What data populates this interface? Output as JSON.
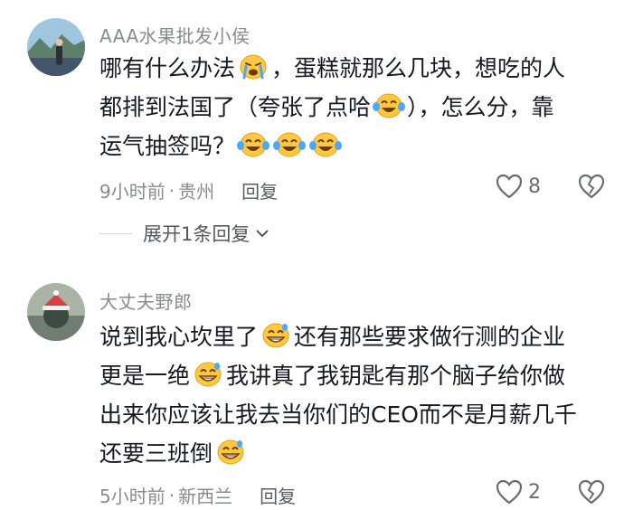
{
  "comments": [
    {
      "author": "AAA水果批发小侯",
      "lines": [
        {
          "segments": [
            "哪有什么办法",
            "emoji:sob",
            "，蛋糕就那么几块，想吃的人"
          ]
        },
        {
          "segments": [
            "都排到法国了（夸张了点哈",
            "emoji:laugh-cry",
            "），怎么分，靠"
          ]
        },
        {
          "segments": [
            "运气抽签吗？",
            "emoji:laugh-cry",
            "emoji:laugh-cry",
            "emoji:laugh-cry"
          ]
        }
      ],
      "time": "9小时前",
      "location": "贵州",
      "reply": "回复",
      "likes": "8",
      "expand_replies": "展开1条回复"
    },
    {
      "author": "大丈夫野郎",
      "lines": [
        {
          "segments": [
            "说到我心坎里了",
            "emoji:grin-sweat",
            "还有那些要求做行测的企业"
          ]
        },
        {
          "segments": [
            "更是一绝",
            "emoji:grin-sweat",
            "我讲真了我钥匙有那个脑子给你做"
          ]
        },
        {
          "segments": [
            "出来你应该让我去当你们的CEO而不是月薪几千"
          ]
        },
        {
          "segments": [
            "还要三班倒",
            "emoji:grin-sweat"
          ]
        }
      ],
      "time": "5小时前",
      "location": "新西兰",
      "reply": "回复",
      "likes": "2"
    }
  ],
  "icons": {
    "like": "heart-outline-icon",
    "dislike": "broken-heart-icon",
    "expand": "chevron-down-icon"
  },
  "colors": {
    "text": "#161823",
    "meta": "#8a8b91",
    "emoji_face": "#ffc83d",
    "emoji_tear": "#4aa8ff"
  }
}
